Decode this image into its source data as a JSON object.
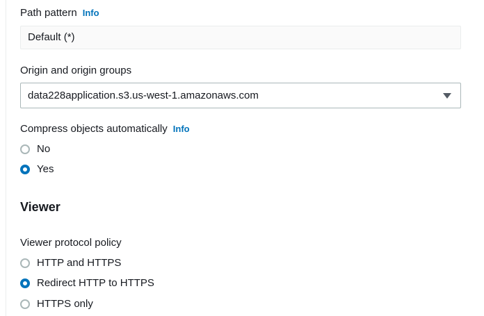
{
  "path_pattern": {
    "label": "Path pattern",
    "info": "Info",
    "value": "Default (*)"
  },
  "origin": {
    "label": "Origin and origin groups",
    "value": "data228application.s3.us-west-1.amazonaws.com"
  },
  "compress": {
    "label": "Compress objects automatically",
    "info": "Info",
    "options": [
      {
        "label": "No",
        "selected": false
      },
      {
        "label": "Yes",
        "selected": true
      }
    ]
  },
  "viewer": {
    "heading": "Viewer",
    "protocol_label": "Viewer protocol policy",
    "options": [
      {
        "label": "HTTP and HTTPS",
        "selected": false
      },
      {
        "label": "Redirect HTTP to HTTPS",
        "selected": true
      },
      {
        "label": "HTTPS only",
        "selected": false
      }
    ]
  },
  "colors": {
    "accent": "#0073bb",
    "text": "#16191f",
    "border": "#aab7b8"
  }
}
